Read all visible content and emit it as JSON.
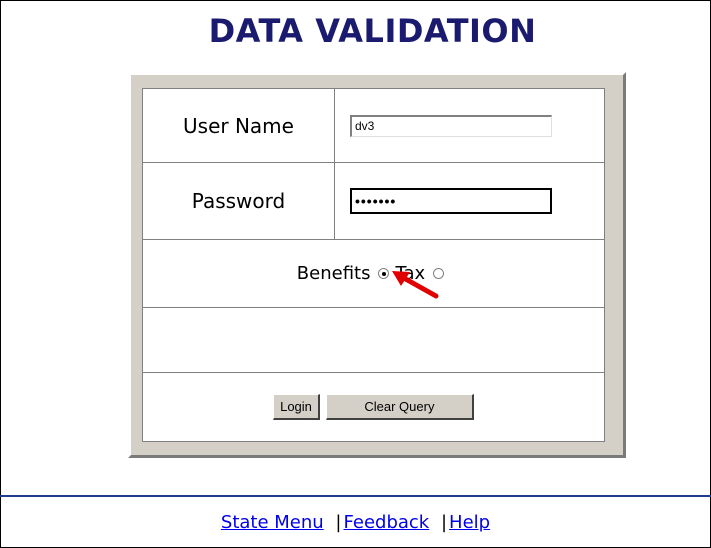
{
  "page": {
    "title": "DATA VALIDATION"
  },
  "form": {
    "username_label": "User Name",
    "username_value": "dv3",
    "password_label": "Password",
    "password_value": "•••••••",
    "radio_options": [
      {
        "label": "Benefits",
        "checked": true
      },
      {
        "label": "Tax",
        "checked": false
      }
    ],
    "login_label": "Login",
    "clear_label": "Clear Query"
  },
  "footer": {
    "links": [
      "State Menu",
      "Feedback",
      "Help"
    ],
    "separator": "|"
  },
  "colors": {
    "title": "#1a1a6e",
    "panel_bg": "#d4d0c8",
    "divider": "#1f3f8c",
    "link": "#0000ee",
    "annotation_arrow": "#e00000"
  },
  "annotation": {
    "arrow_icon": "red-arrow-icon"
  }
}
